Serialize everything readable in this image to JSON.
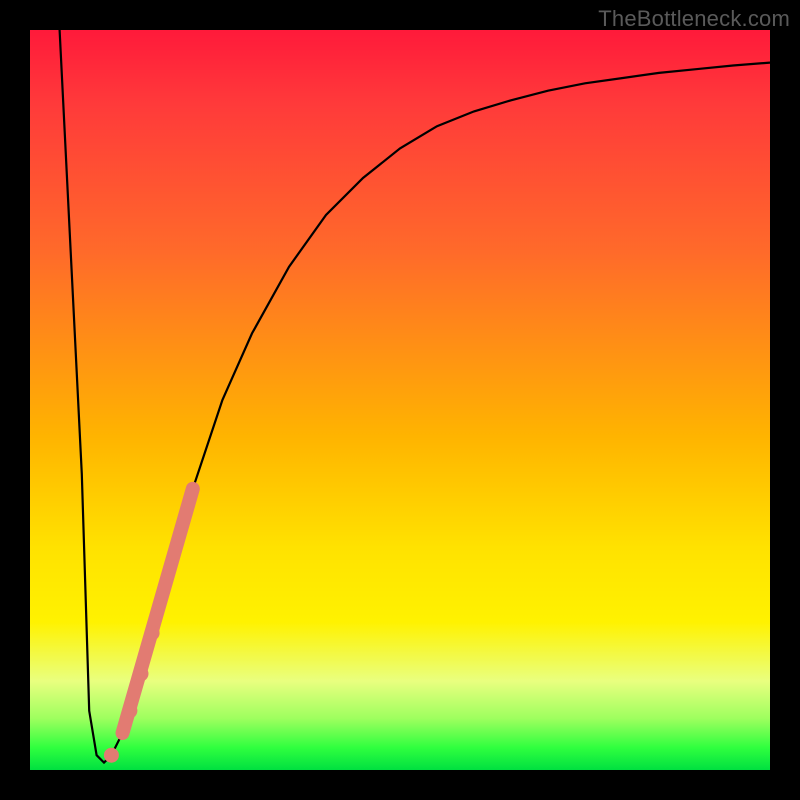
{
  "watermark": "TheBottleneck.com",
  "colors": {
    "curve": "#000000",
    "marker": "#e27b72",
    "gradient_top": "#ff1a3a",
    "gradient_bottom": "#00e040"
  },
  "chart_data": {
    "type": "line",
    "title": "",
    "xlabel": "",
    "ylabel": "",
    "xlim": [
      0,
      100
    ],
    "ylim": [
      0,
      100
    ],
    "series": [
      {
        "name": "bottleneck-curve",
        "x": [
          4,
          7,
          8,
          9,
          10,
          11,
          12.5,
          15,
          18,
          22,
          26,
          30,
          35,
          40,
          45,
          50,
          55,
          60,
          65,
          70,
          75,
          80,
          85,
          90,
          95,
          100
        ],
        "y": [
          100,
          40,
          8,
          2,
          1,
          2,
          5,
          13,
          24,
          38,
          50,
          59,
          68,
          75,
          80,
          84,
          87,
          89,
          90.5,
          91.8,
          92.8,
          93.5,
          94.2,
          94.7,
          95.2,
          95.6
        ]
      }
    ],
    "highlight_segment": {
      "name": "highlighted-range",
      "x": [
        12.5,
        22
      ],
      "y": [
        5,
        38
      ]
    },
    "highlight_dots": [
      {
        "x": 11.0,
        "y": 2.0
      },
      {
        "x": 13.5,
        "y": 8.0
      },
      {
        "x": 15.0,
        "y": 13.0
      },
      {
        "x": 16.5,
        "y": 18.5
      }
    ]
  }
}
